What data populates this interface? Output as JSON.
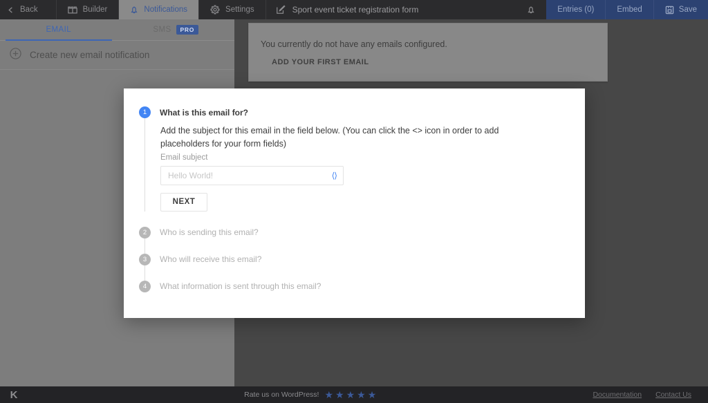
{
  "topbar": {
    "back_label": "Back",
    "back_icon": "chevron-left-icon",
    "builder_label": "Builder",
    "builder_icon": "blocks-icon",
    "notifications_label": "Notifications",
    "notifications_icon": "bell-icon",
    "settings_label": "Settings",
    "settings_icon": "gear-icon",
    "form_title": "Sport event ticket registration form",
    "form_title_icon": "pencil-edit-icon",
    "alert_icon": "bell-icon",
    "entries_label": "Entries (0)",
    "embed_label": "Embed",
    "save_label": "Save",
    "save_icon": "floppy-disk-icon",
    "active_tab": "Notifications",
    "accent_blue": "#3b5998",
    "bar_bg": "#2b2b2d",
    "right_bg": "#2c4272"
  },
  "sidebar": {
    "tabs": [
      {
        "label": "EMAIL",
        "active": true
      },
      {
        "label": "SMS",
        "active": false,
        "badge": "PRO"
      }
    ],
    "create_label": "Create new email notification",
    "create_icon": "plus-circle-icon"
  },
  "main": {
    "empty_state": {
      "message": "You currently do not have any emails configured.",
      "button_label": "ADD YOUR FIRST EMAIL"
    }
  },
  "modal": {
    "steps": [
      {
        "number": "1",
        "title": "What is this email for?",
        "active": true,
        "description": "Add the subject for this email in the field below. (You can click the <> icon in order to add placeholders for your form fields)",
        "field_label": "Email subject",
        "input_value": "",
        "input_placeholder": "Hello World!",
        "code_icon": "code-brackets-icon",
        "next_label": "NEXT"
      },
      {
        "number": "2",
        "title": "Who is sending this email?",
        "active": false
      },
      {
        "number": "3",
        "title": "Who will receive this email?",
        "active": false
      },
      {
        "number": "4",
        "title": "What information is sent through this email?",
        "active": false
      }
    ],
    "active_bullet_color": "#4285f4",
    "inactive_bullet_color": "#b7b7b7"
  },
  "bottombar": {
    "logo": "K",
    "rate_label": "Rate us on WordPress!",
    "stars": 5,
    "star_color": "#3b5998",
    "links": [
      {
        "label": "Documentation"
      },
      {
        "label": "Contact Us"
      }
    ]
  }
}
